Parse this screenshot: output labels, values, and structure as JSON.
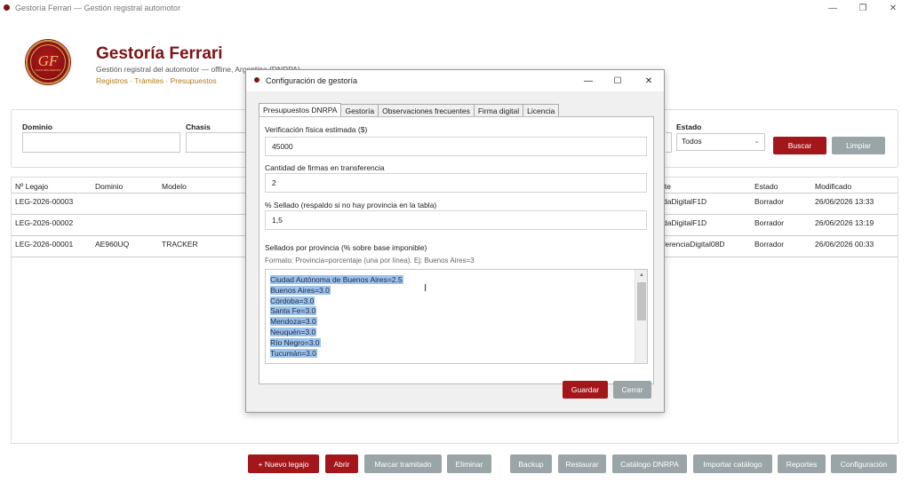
{
  "window": {
    "title": "Gestoría Ferrari — Gestión registral automotor",
    "controls": {
      "minimize": "—",
      "maximize": "❐",
      "close": "✕"
    }
  },
  "header": {
    "logo_text": "GF",
    "logo_subtext": "GESTORÍA FERRARI",
    "title": "Gestoría Ferrari",
    "subtitle": "Gestión registral del automotor — offline, Argentina (DNRPA)",
    "links": "Registros · Trámites · Presupuestos"
  },
  "filters": {
    "dominio_label": "Dominio",
    "chasis_label": "Chasis",
    "estado_label": "Estado",
    "estado_value": "Todos",
    "buscar_label": "Buscar",
    "limpiar_label": "Limpiar"
  },
  "table": {
    "columns": [
      "Nº Legajo",
      "Dominio",
      "Modelo",
      "Trámite",
      "Estado",
      "Modificado"
    ],
    "rows": [
      {
        "legajo": "LEG-2026-00003",
        "dominio": "",
        "modelo": "",
        "tramite": "daDigitalF1D",
        "estado": "Borrador",
        "modificado": "26/06/2026 13:33"
      },
      {
        "legajo": "LEG-2026-00002",
        "dominio": "",
        "modelo": "",
        "tramite": "daDigitalF1D",
        "estado": "Borrador",
        "modificado": "26/06/2026 13:19"
      },
      {
        "legajo": "LEG-2026-00001",
        "dominio": "AE960UQ",
        "modelo": "TRACKER",
        "tramite": "ferenciaDigital08D",
        "estado": "Borrador",
        "modificado": "26/06/2026 00:33"
      }
    ],
    "tramite_header_visible": "ite"
  },
  "actions": {
    "nuevo_legajo": "+ Nuevo legajo",
    "abrir": "Abrir",
    "marcar_tramitado": "Marcar tramitado",
    "eliminar": "Eliminar",
    "backup": "Backup",
    "restaurar": "Restaurar",
    "catalogo_dnrpa": "Catálogo DNRPA",
    "importar_catalogo": "Importar catálogo",
    "reportes": "Reportes",
    "configuracion": "Configuración"
  },
  "dialog": {
    "title": "Configuración de gestoría",
    "controls": {
      "minimize": "—",
      "maximize": "☐",
      "close": "✕"
    },
    "tabs": [
      "Presupuestos DNRPA",
      "Gestoría",
      "Observaciones frecuentes",
      "Firma digital",
      "Licencia"
    ],
    "active_tab": "Presupuestos DNRPA",
    "fields": {
      "verificacion_label": "Verificación física estimada ($)",
      "verificacion_value": "45000",
      "firmas_label": "Cantidad de firmas en transferencia",
      "firmas_value": "2",
      "sellado_label": "% Sellado (respaldo si no hay provincia en la tabla)",
      "sellado_value": "1,5",
      "provincias_label": "Sellados por provincia (% sobre base imponible)",
      "provincias_hint": "Formato: Provincia=porcentaje (una por línea). Ej: Buenos Aires=3"
    },
    "provincias_lines": [
      "Ciudad Autónoma de Buenos Aires=2.5",
      "Buenos Aires=3.0",
      "Córdoba=3.0",
      "Santa Fe=3.0",
      "Mendoza=3.0",
      "Neuquén=3.0",
      "Río Negro=3.0",
      "Tucumán=3.0"
    ],
    "guardar_label": "Guardar",
    "cerrar_label": "Cerrar"
  },
  "colors": {
    "brand_red": "#a3161a",
    "title_red": "#7a1416",
    "link_gold": "#b07b1d",
    "button_grey": "#9aa5a7",
    "selection_blue": "#9ec3ea"
  },
  "icons": {
    "cursor": "text-cursor-icon",
    "dropdown": "chevron-down-icon"
  }
}
